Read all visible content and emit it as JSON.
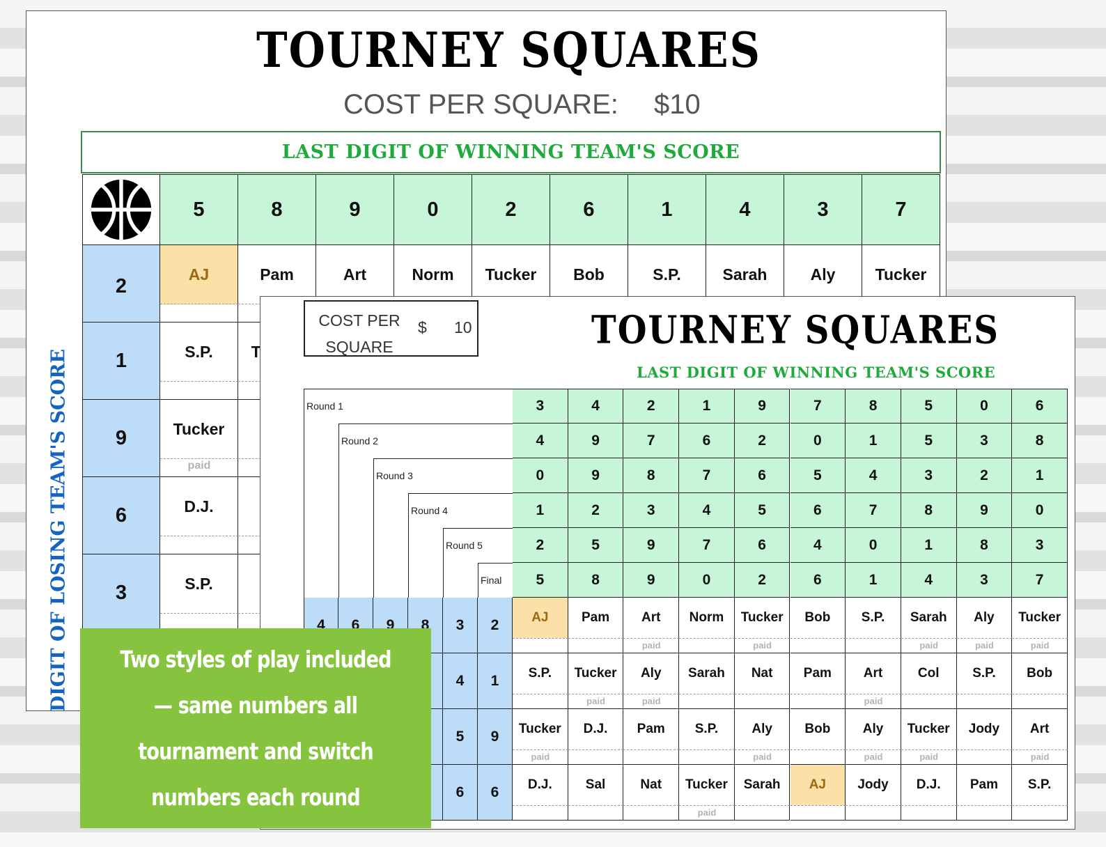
{
  "sheet1": {
    "title": "TOURNEY SQUARES",
    "cost_label": "COST PER SQUARE:",
    "cost_value": "$10",
    "winning_label": "LAST DIGIT OF WINNING TEAM'S SCORE",
    "losing_label": "LAST DIGIT OF LOSING TEAM'S SCORE",
    "icon": "basketball-icon",
    "col_digits": [
      "5",
      "8",
      "9",
      "0",
      "2",
      "6",
      "1",
      "4",
      "3",
      "7"
    ],
    "row_digits": [
      "2",
      "1",
      "9",
      "6",
      "3"
    ],
    "rows": [
      {
        "names": [
          "AJ",
          "Pam",
          "Art",
          "Norm",
          "Tucker",
          "Bob",
          "S.P.",
          "Sarah",
          "Aly",
          "Tucker"
        ],
        "paid": [],
        "highlight": [
          0
        ]
      },
      {
        "names": [
          "S.P.",
          "Tucker"
        ],
        "paid": [],
        "highlight": []
      },
      {
        "names": [
          "Tucker"
        ],
        "paid": [
          0
        ],
        "highlight": []
      },
      {
        "names": [
          "D.J."
        ],
        "paid": [],
        "highlight": []
      },
      {
        "names": [
          "S.P."
        ],
        "paid": [],
        "highlight": []
      }
    ]
  },
  "sheet2": {
    "title": "TOURNEY SQUARES",
    "cost_label": "COST PER SQUARE",
    "cost_currency": "$",
    "cost_value": "10",
    "winning_label": "LAST DIGIT OF WINNING TEAM'S SCORE",
    "rounds": [
      {
        "label": "Round 1",
        "digits": [
          "3",
          "4",
          "2",
          "1",
          "9",
          "7",
          "8",
          "5",
          "0",
          "6"
        ]
      },
      {
        "label": "Round 2",
        "digits": [
          "4",
          "9",
          "7",
          "6",
          "2",
          "0",
          "1",
          "5",
          "3",
          "8"
        ]
      },
      {
        "label": "Round 3",
        "digits": [
          "0",
          "9",
          "8",
          "7",
          "6",
          "5",
          "4",
          "3",
          "2",
          "1"
        ]
      },
      {
        "label": "Round 4",
        "digits": [
          "1",
          "2",
          "3",
          "4",
          "5",
          "6",
          "7",
          "8",
          "9",
          "0"
        ]
      },
      {
        "label": "Round 5",
        "digits": [
          "2",
          "5",
          "9",
          "7",
          "6",
          "4",
          "0",
          "1",
          "8",
          "3"
        ]
      },
      {
        "label": "Final",
        "digits": [
          "5",
          "8",
          "9",
          "0",
          "2",
          "6",
          "1",
          "4",
          "3",
          "7"
        ]
      }
    ],
    "row_digits": [
      [
        "4",
        "6",
        "9",
        "8",
        "3",
        "2"
      ],
      [
        "",
        "",
        "",
        "",
        "4",
        "1"
      ],
      [
        "",
        "",
        "",
        "",
        "5",
        "9"
      ],
      [
        "",
        "",
        "",
        "",
        "6",
        "6"
      ]
    ],
    "paid_text": "paid",
    "rows": [
      {
        "names": [
          "AJ",
          "Pam",
          "Art",
          "Norm",
          "Tucker",
          "Bob",
          "S.P.",
          "Sarah",
          "Aly",
          "Tucker"
        ],
        "paid": [
          2,
          4,
          7,
          8,
          9
        ],
        "highlight": [
          0
        ]
      },
      {
        "names": [
          "S.P.",
          "Tucker",
          "Aly",
          "Sarah",
          "Nat",
          "Pam",
          "Art",
          "Col",
          "S.P.",
          "Bob"
        ],
        "paid": [
          1,
          2,
          6
        ],
        "highlight": []
      },
      {
        "names": [
          "Tucker",
          "D.J.",
          "Pam",
          "S.P.",
          "Aly",
          "Bob",
          "Aly",
          "Tucker",
          "Jody",
          "Art"
        ],
        "paid": [
          0,
          4,
          6,
          7,
          9
        ],
        "highlight": []
      },
      {
        "names": [
          "D.J.",
          "Sal",
          "Nat",
          "Tucker",
          "Sarah",
          "AJ",
          "Jody",
          "D.J.",
          "Pam",
          "S.P."
        ],
        "paid": [
          3
        ],
        "highlight": [
          5
        ]
      }
    ]
  },
  "promo": {
    "lines": [
      "Two styles of play included",
      "— same numbers all",
      "tournament and switch",
      "numbers each round"
    ]
  },
  "colors": {
    "header_green": "#c6f5d8",
    "row_blue": "#bcdcf8",
    "highlight": "#fbe0a8",
    "promo_green": "#86c440",
    "label_green": "#1faa3c",
    "label_blue": "#1565c0"
  }
}
